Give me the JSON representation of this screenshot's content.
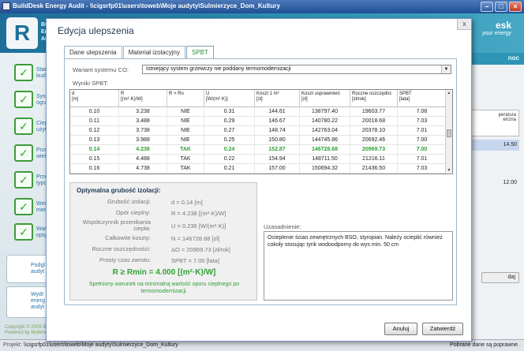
{
  "app": {
    "title": "BuildDesk Energy Audit - \\\\cigsrfp01\\users\\toweb\\Moje audyty\\Sulmierzyce_Dom_Kultury",
    "logo_letter": "R",
    "header_text_lines": [
      "Bui",
      "Ener",
      "Audi"
    ],
    "brand_right": "esk",
    "brand_right_sub": "your energy",
    "right_header": "noc"
  },
  "sidebar": {
    "items": [
      {
        "label": "Stan",
        "label2": "budy",
        "icon": "check-list-icon"
      },
      {
        "label": "Syste",
        "label2": "ogrze",
        "icon": "heating-icon"
      },
      {
        "label": "Ciepł",
        "label2": "użytk",
        "icon": "heat-icon"
      },
      {
        "label": "Przeg",
        "label2": "wielo",
        "icon": "review-icon"
      },
      {
        "label": "Przeg",
        "label2": "typo",
        "icon": "review-icon"
      },
      {
        "label": "Wenty",
        "label2": "mech",
        "icon": "ventilation-icon"
      },
      {
        "label": "Warit",
        "label2": "optyr",
        "icon": "variant-icon"
      }
    ],
    "tiles": [
      {
        "label": "Podgl",
        "label2": "audyt"
      },
      {
        "label": "Wydr",
        "label2": "energ",
        "label3": "audyt"
      }
    ],
    "copyright": [
      "Copyright © 2009 B",
      "Powered by Multime"
    ]
  },
  "right_panel": {
    "tab_lines": [
      "peratura",
      "etrzna"
    ],
    "rows": [
      "14.50",
      "",
      "12.00"
    ],
    "button": "daj"
  },
  "statusbar": {
    "project_label": "Projekt:",
    "project_path": "\\\\cigsrfp01\\users\\toweb\\Moje audyty\\Sulmierzyce_Dom_Kultury",
    "status": "Pobrane dane są poprawne."
  },
  "dialog": {
    "title": "Edycja ulepszenia",
    "close": "x",
    "tabs": [
      "Dane ulepszenia",
      "Materiał izolacyjny",
      "SPBT"
    ],
    "active_tab": 2,
    "co_label": "Wariant systemu CO:",
    "co_value": "Istniejący system grzewczy nie poddany termomodernizacji",
    "results_label": "Wyniki SPBT:",
    "columns": [
      [
        "d",
        "[m]"
      ],
      [
        "R",
        "[(m²·K)/W]"
      ],
      [
        "R > Ro",
        ""
      ],
      [
        "U",
        "[W/(m²·K)]"
      ],
      [
        "Koszt 1 m²",
        "[zł]"
      ],
      [
        "Koszt usprawnieni",
        "[zł]"
      ],
      [
        "Roczne oszczędnc",
        "[zł/rok]"
      ],
      [
        "SPBT",
        "[lata]"
      ]
    ],
    "rows": [
      [
        "0.10",
        "3.238",
        "NIE",
        "0.31",
        "144.61",
        "138797.40",
        "19603.77",
        "7.08"
      ],
      [
        "0.11",
        "3.488",
        "NIE",
        "0.29",
        "146.67",
        "140780.22",
        "20018.68",
        "7.03"
      ],
      [
        "0.12",
        "3.738",
        "NIE",
        "0.27",
        "148.74",
        "142763.04",
        "20378.10",
        "7.01"
      ],
      [
        "0.13",
        "3.988",
        "NIE",
        "0.25",
        "150.80",
        "144745.86",
        "20692.46",
        "7.00"
      ],
      [
        "0.14",
        "4.238",
        "TAK",
        "0.24",
        "152.87",
        "146728.68",
        "20969.73",
        "7.00"
      ],
      [
        "0.15",
        "4.488",
        "TAK",
        "0.22",
        "154.94",
        "148711.50",
        "21216.11",
        "7.01"
      ],
      [
        "0.16",
        "4.738",
        "TAK",
        "0.21",
        "157.00",
        "150694.32",
        "21436.50",
        "7.03"
      ]
    ],
    "selected_row": 4,
    "optimal": {
      "title": "Optymalna grubość izolacji:",
      "items": [
        {
          "label": "Grubość izolacji:",
          "value": "d = 0.14 [m]"
        },
        {
          "label": "Opór cieplny:",
          "value": "R = 4.238 [(m²·K)/W]"
        },
        {
          "label": "Współczynnik przenikania ciepła:",
          "value": "U = 0.236 [W/(m²·K)]"
        },
        {
          "label": "Całkowite koszty:",
          "value": "N = 146728.68 [zł]"
        },
        {
          "label": "Roczne oszczędności:",
          "value": "ΔO = 20969.73 [zł/rok]"
        },
        {
          "label": "Prosty czas zwrotu:",
          "value": "SPBT = 7.00 [lata]"
        }
      ],
      "formula": "R ≥ Rmin = 4.000 [(m²·K)/W]",
      "note": "Spełniony warunek na minimalną wartość oporu cieplnego po termomodernizacji."
    },
    "justification_label": "Uzasadnienie:",
    "justification": "Ocieplenie ścian zewnętrznych BSO, styropian. Należy ocieplić również cokoły stosując tynk wodoodporny do wys min. 50 cm",
    "cancel": "Anuluj",
    "approve": "Zatwierdź"
  }
}
